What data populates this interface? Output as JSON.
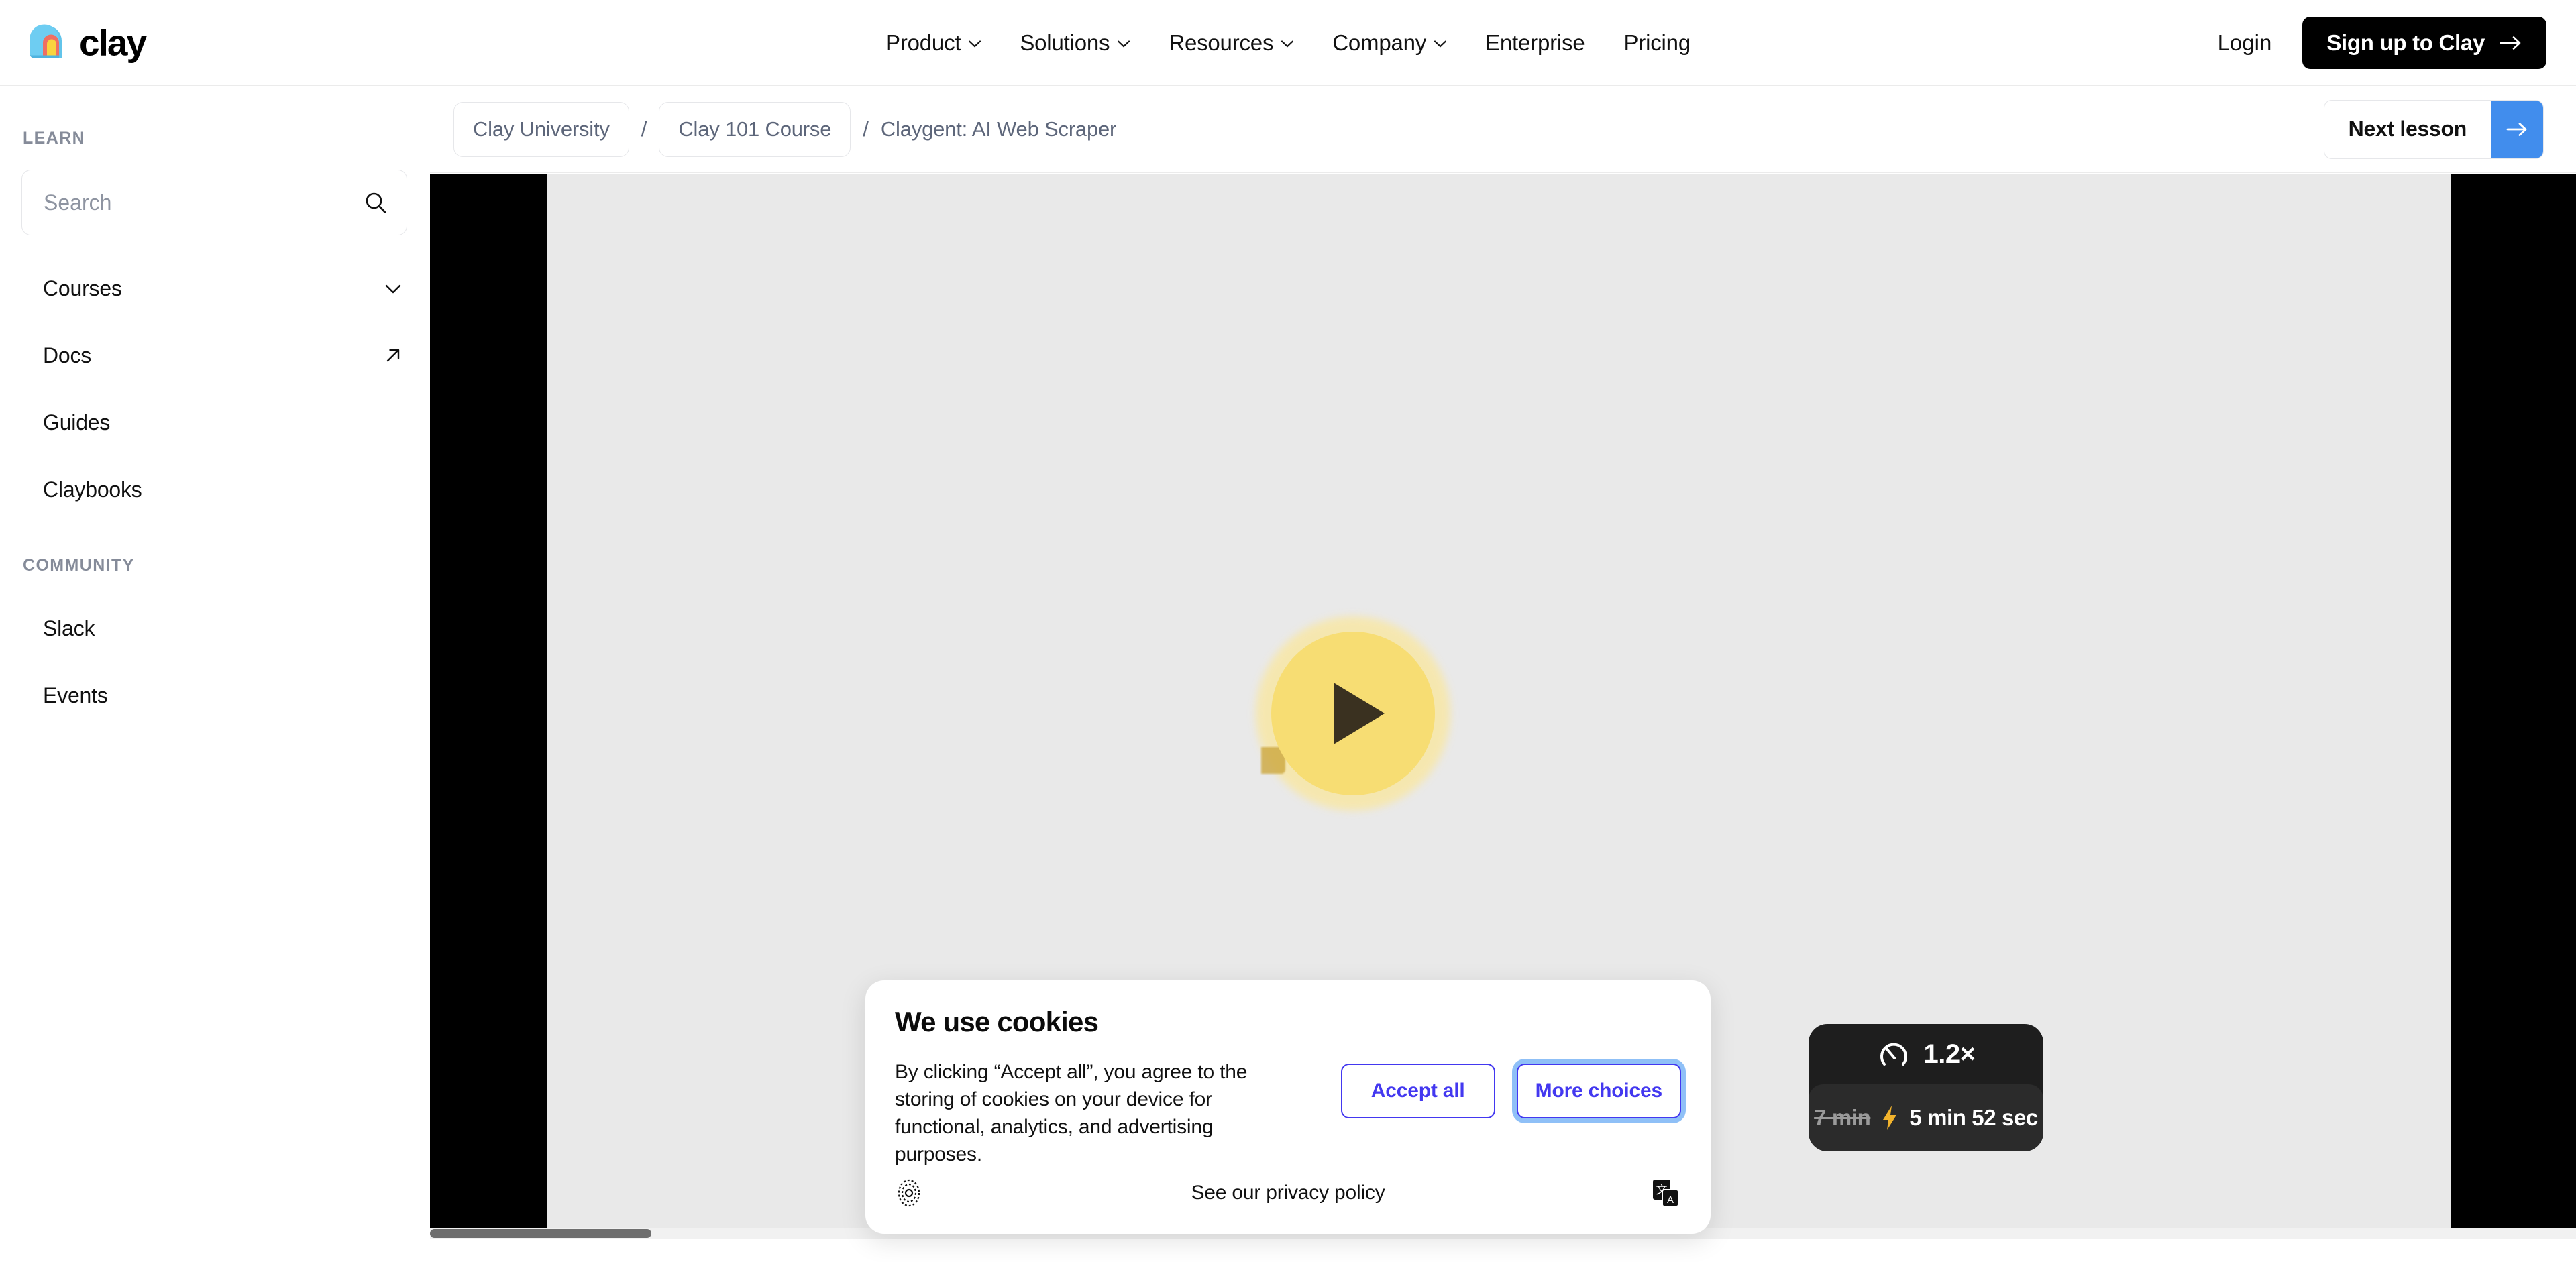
{
  "brand": {
    "name": "clay",
    "logo_icon": "clay-arch-logo"
  },
  "topnav": {
    "items": [
      {
        "label": "Product",
        "has_chevron": true
      },
      {
        "label": "Solutions",
        "has_chevron": true
      },
      {
        "label": "Resources",
        "has_chevron": true
      },
      {
        "label": "Company",
        "has_chevron": true
      },
      {
        "label": "Enterprise",
        "has_chevron": false
      },
      {
        "label": "Pricing",
        "has_chevron": false
      }
    ],
    "login_label": "Login",
    "signup_label": "Sign up to Clay"
  },
  "sidebar": {
    "learn_label": "LEARN",
    "community_label": "COMMUNITY",
    "search": {
      "value": "",
      "placeholder": "Search",
      "icon": "search-icon"
    },
    "learn_items": [
      {
        "label": "Courses",
        "icon": "chevron-down-icon"
      },
      {
        "label": "Docs",
        "icon": "external-link-icon"
      },
      {
        "label": "Guides",
        "icon": ""
      },
      {
        "label": "Claybooks",
        "icon": ""
      }
    ],
    "community_items": [
      {
        "label": "Slack",
        "icon": ""
      },
      {
        "label": "Events",
        "icon": ""
      }
    ]
  },
  "breadcrumb": {
    "chips": [
      "Clay University",
      "Clay 101 Course"
    ],
    "separator": "/",
    "current": "Claygent: AI Web Scraper"
  },
  "next_lesson": {
    "label": "Next lesson",
    "icon": "arrow-right-icon",
    "accent": "#418ded"
  },
  "player": {
    "play_icon": "play-icon",
    "speed_icon": "gauge-icon",
    "speed_value": "1.2×",
    "bolt_icon": "lightning-bolt-icon",
    "original_duration": "7 min",
    "adjusted_duration": "5 min 52 sec"
  },
  "cookie_dialog": {
    "title": "We use cookies",
    "body": "By clicking “Accept all”, you agree to the storing of cookies on your device for functional, analytics, and advertising purposes.",
    "accept_label": "Accept all",
    "more_label": "More choices",
    "privacy_label": "See our privacy policy",
    "settings_icon": "cookie-settings-icon",
    "translate_icon": "translate-icon",
    "accent": "#4338f0",
    "focus_ring": "#8fc0f7"
  }
}
